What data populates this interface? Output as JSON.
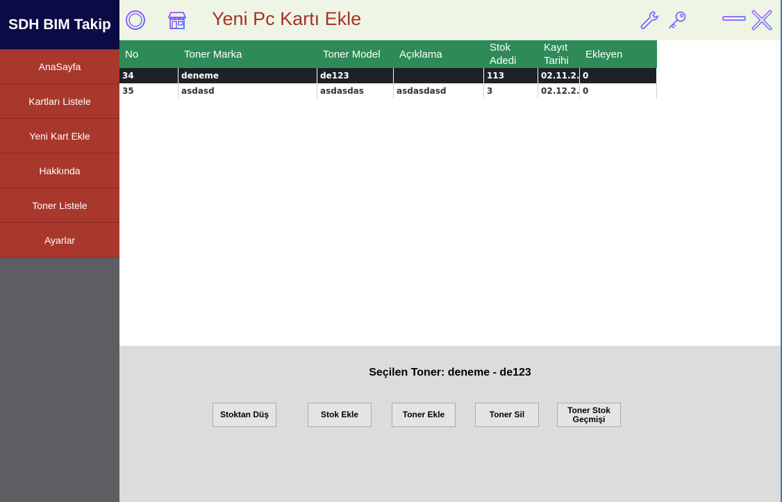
{
  "app": {
    "brand": "SDH BIM Takip",
    "title": "Yeni Pc Kartı Ekle"
  },
  "sidebar": {
    "items": [
      {
        "label": "AnaSayfa"
      },
      {
        "label": "Kartları Listele"
      },
      {
        "label": "Yeni Kart Ekle"
      },
      {
        "label": "Hakkında"
      },
      {
        "label": "Toner Listele"
      },
      {
        "label": "Ayarlar"
      }
    ]
  },
  "header_icons": [
    "menu-circle-icon",
    "store-icon",
    "wrench-icon",
    "key-icon",
    "minimize-icon",
    "close-icon"
  ],
  "table": {
    "columns": [
      "No",
      "Toner Marka",
      "Toner Model",
      "Açıklama",
      "Stok Adedi",
      "Kayıt Tarihi",
      "Ekleyen"
    ],
    "rows": [
      [
        "34",
        "deneme",
        "de123",
        "",
        "113",
        "02.11.2...",
        "0"
      ],
      [
        "35",
        "asdasd",
        "asdasdas",
        "asdasdasd",
        "3",
        "02.12.2...",
        "0"
      ]
    ],
    "selected_row": 0
  },
  "panel": {
    "selected_label": "Seçilen Toner: deneme - de123",
    "buttons": [
      {
        "label": "Stoktan Düş"
      },
      {
        "label": "Stok Ekle"
      },
      {
        "label": "Toner Ekle"
      },
      {
        "label": "Toner Sil"
      },
      {
        "label": "Toner Stok Geçmişi"
      }
    ]
  },
  "colors": {
    "brand_bg": "#0b0b45",
    "nav_bg": "#a8372c",
    "sidebar_bg": "#5d5d62",
    "header_bg": "#eef5e4",
    "title": "#a63229",
    "grid_header": "#2e8b57",
    "selected_row": "#1e2128",
    "panel_bg": "#dcdcdc",
    "icon_accent": "#8a4cf0"
  }
}
